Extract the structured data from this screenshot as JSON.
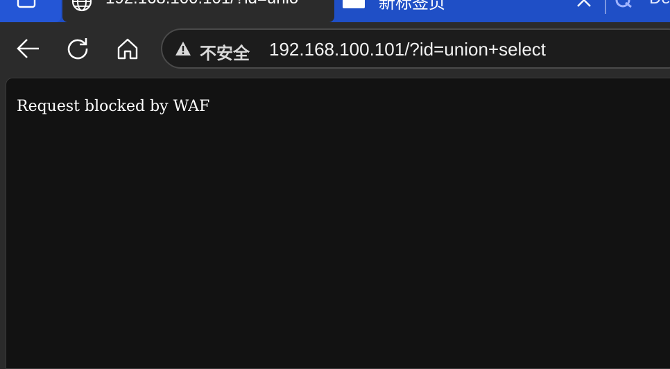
{
  "tabs": {
    "active": {
      "title": "192.168.100.101/?id=unio",
      "icon": "globe-icon"
    },
    "inactive": {
      "title": "新标签页",
      "icon": "page-icon"
    },
    "third": {
      "title": "De",
      "icon": "logo-icon"
    }
  },
  "toolbar": {
    "security_label": "不安全",
    "url": "192.168.100.101/?id=union+select"
  },
  "page": {
    "body_text": "Request blocked by WAF"
  },
  "colors": {
    "tab_strip": "#1f4fc6",
    "toolbar": "#2b2b2b",
    "page_background": "#121212",
    "text": "#ffffff"
  }
}
